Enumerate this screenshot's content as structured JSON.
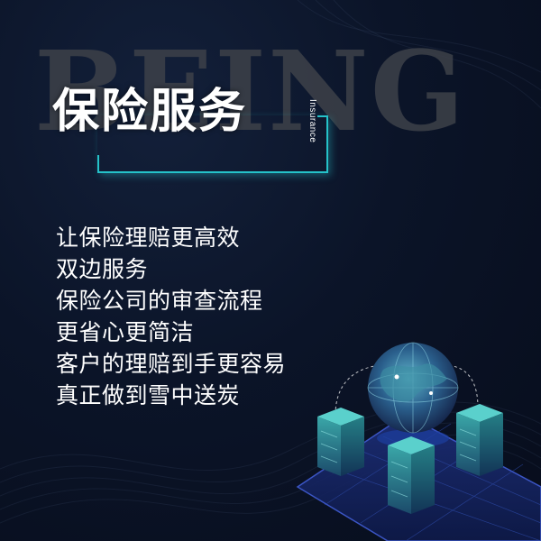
{
  "background_word": "BEING",
  "title": "保险服务",
  "subtitle": "Insurance",
  "lines": [
    "让保险理赔更高效",
    "双边服务",
    "保险公司的审查流程",
    "更省心更简洁",
    "客户的理赔到手更容易",
    "真正做到雪中送炭"
  ],
  "colors": {
    "background": "#0b1428",
    "accent": "#25c2c9",
    "text": "#ffffff",
    "watermark": "#3d4149"
  }
}
